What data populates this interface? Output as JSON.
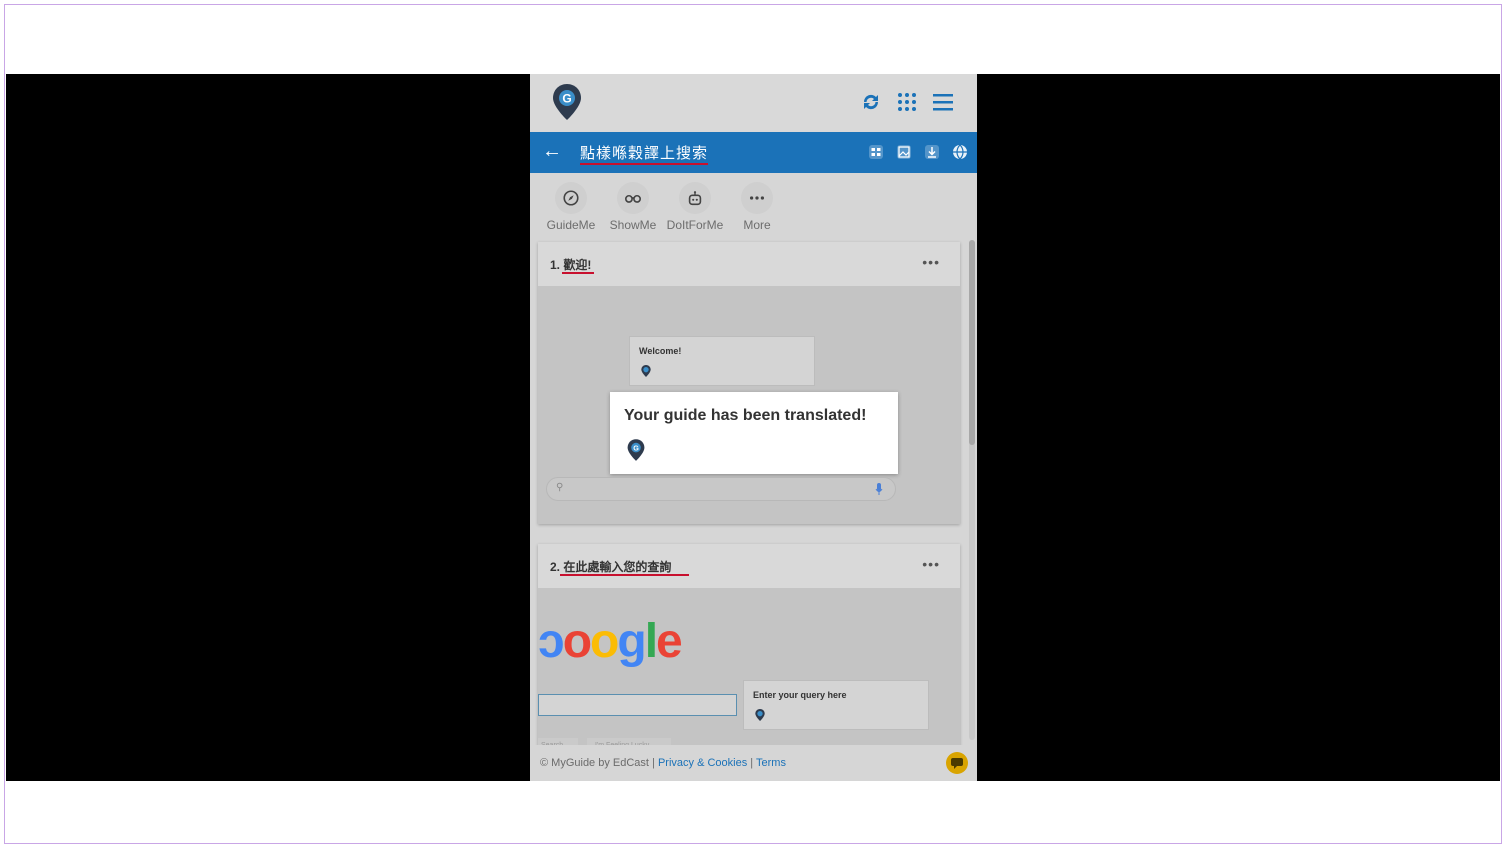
{
  "header": {
    "logo_letter": "G"
  },
  "guide": {
    "title": "點樣喺穀譯上搜索"
  },
  "modes": [
    {
      "label": "GuideMe",
      "icon": "compass-icon"
    },
    {
      "label": "ShowMe",
      "icon": "binoculars-icon"
    },
    {
      "label": "DoItForMe",
      "icon": "robot-icon"
    },
    {
      "label": "More",
      "icon": "more-dots-icon"
    }
  ],
  "steps": [
    {
      "title": "1. 歡迎!",
      "popup_small": "Welcome!",
      "popup_large": "Your guide has been translated!"
    },
    {
      "title": "2. 在此處輸入您的查詢",
      "logo_text": "oogle",
      "popup_small": "Enter your query here",
      "buttons": [
        "Search",
        "I'm Feeling Lucky"
      ]
    }
  ],
  "more_dots": "•••",
  "footer": {
    "copyright": "© MyGuide by EdCast",
    "sep": "|",
    "privacy": "Privacy & Cookies",
    "terms": "Terms"
  },
  "colors": {
    "brand_blue": "#1b72b8",
    "underline_red": "#c8102e",
    "chat_yellow": "#d9a400"
  }
}
